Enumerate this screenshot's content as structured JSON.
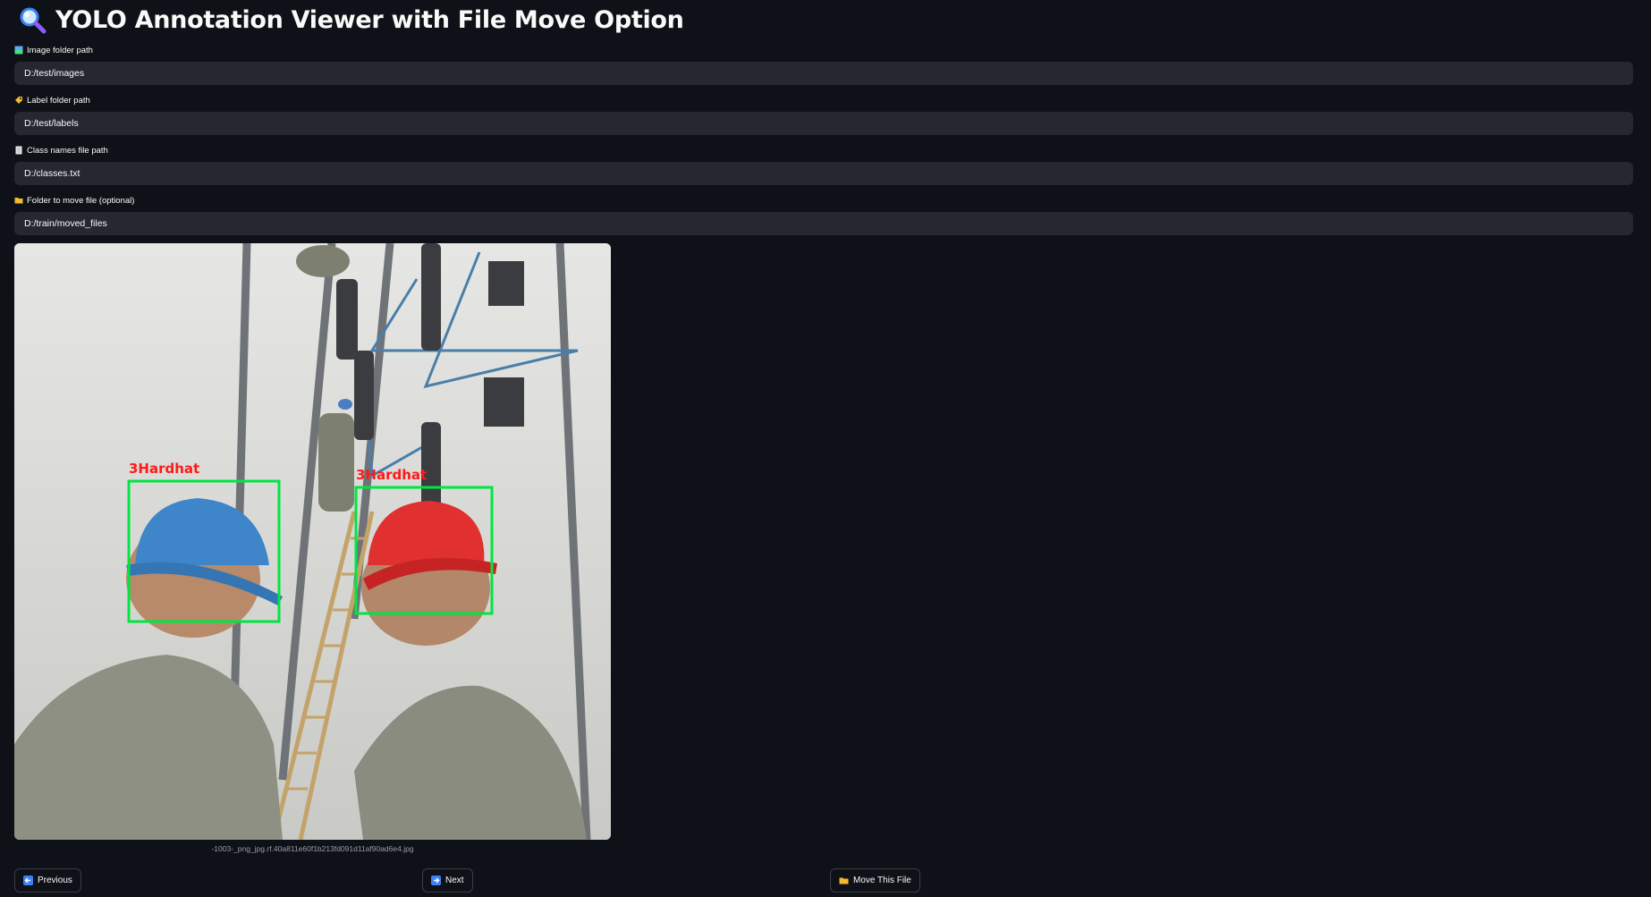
{
  "header": {
    "icon": "magnifier-icon",
    "title": "YOLO Annotation Viewer with File Move Option"
  },
  "fields": [
    {
      "icon": "picture-icon",
      "label": "Image folder path",
      "value": "D:/test/images"
    },
    {
      "icon": "label-tag-icon",
      "label": "Label folder path",
      "value": "D:/test/labels"
    },
    {
      "icon": "document-icon",
      "label": "Class names file path",
      "value": "D:/classes.txt"
    },
    {
      "icon": "folder-icon",
      "label": "Folder to move file (optional)",
      "value": "D:/train/moved_files"
    }
  ],
  "viewer": {
    "annotations": [
      {
        "label": "3Hardhat",
        "color": "#00e640"
      },
      {
        "label": "3Hardhat",
        "color": "#00e640"
      }
    ],
    "label_color": "#ff1a1a",
    "caption": "-1003-_png_jpg.rf.40a811e60f1b213fd091d11af90ad6e4.jpg"
  },
  "buttons": {
    "previous": {
      "icon": "left-arrow-icon",
      "label": "Previous"
    },
    "next": {
      "icon": "right-arrow-icon",
      "label": "Next"
    },
    "move": {
      "icon": "folder-icon",
      "label": "Move This File"
    }
  },
  "colors": {
    "background": "#0e1117",
    "input_background": "#262730",
    "accent_blue": "#3b82f6",
    "folder_yellow": "#f5b82e"
  }
}
